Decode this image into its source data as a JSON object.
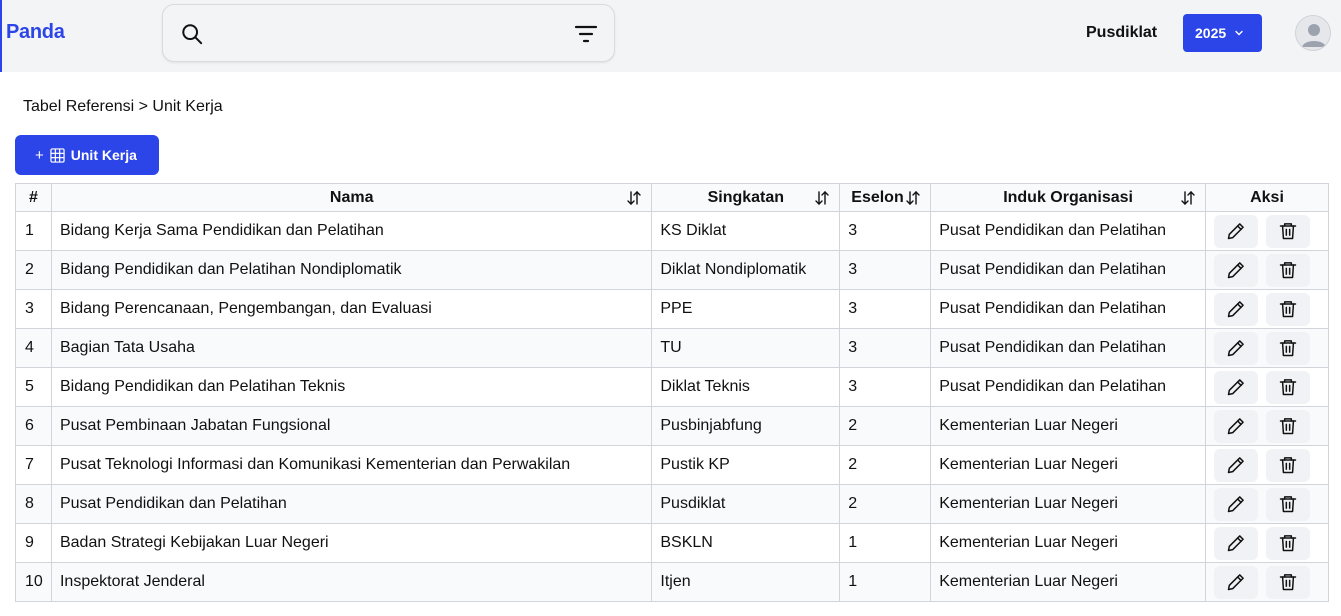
{
  "app": {
    "logo": "Panda",
    "organization": "Pusdiklat",
    "year": "2025",
    "search": {
      "value": ""
    }
  },
  "breadcrumb": "Tabel Referensi > Unit Kerja",
  "add_button": {
    "plus": "+",
    "label": "Unit Kerja"
  },
  "table": {
    "headers": {
      "num": "#",
      "nama": "Nama",
      "singkatan": "Singkatan",
      "eselon": "Eselon",
      "induk": "Induk Organisasi",
      "aksi": "Aksi"
    },
    "rows": [
      {
        "num": "1",
        "nama": "Bidang Kerja Sama Pendidikan dan Pelatihan",
        "singkatan": "KS Diklat",
        "eselon": "3",
        "induk": "Pusat Pendidikan dan Pelatihan"
      },
      {
        "num": "2",
        "nama": "Bidang Pendidikan dan Pelatihan Nondiplomatik",
        "singkatan": "Diklat Nondiplomatik",
        "eselon": "3",
        "induk": "Pusat Pendidikan dan Pelatihan"
      },
      {
        "num": "3",
        "nama": "Bidang Perencanaan, Pengembangan, dan Evaluasi",
        "singkatan": "PPE",
        "eselon": "3",
        "induk": "Pusat Pendidikan dan Pelatihan"
      },
      {
        "num": "4",
        "nama": "Bagian Tata Usaha",
        "singkatan": "TU",
        "eselon": "3",
        "induk": "Pusat Pendidikan dan Pelatihan"
      },
      {
        "num": "5",
        "nama": "Bidang Pendidikan dan Pelatihan Teknis",
        "singkatan": "Diklat Teknis",
        "eselon": "3",
        "induk": "Pusat Pendidikan dan Pelatihan"
      },
      {
        "num": "6",
        "nama": "Pusat Pembinaan Jabatan Fungsional",
        "singkatan": "Pusbinjabfung",
        "eselon": "2",
        "induk": "Kementerian Luar Negeri"
      },
      {
        "num": "7",
        "nama": "Pusat Teknologi Informasi dan Komunikasi Kementerian dan Perwakilan",
        "singkatan": "Pustik KP",
        "eselon": "2",
        "induk": "Kementerian Luar Negeri"
      },
      {
        "num": "8",
        "nama": "Pusat Pendidikan dan Pelatihan",
        "singkatan": "Pusdiklat",
        "eselon": "2",
        "induk": "Kementerian Luar Negeri"
      },
      {
        "num": "9",
        "nama": "Badan Strategi Kebijakan Luar Negeri",
        "singkatan": "BSKLN",
        "eselon": "1",
        "induk": "Kementerian Luar Negeri"
      },
      {
        "num": "10",
        "nama": "Inspektorat Jenderal",
        "singkatan": "Itjen",
        "eselon": "1",
        "induk": "Kementerian Luar Negeri"
      }
    ]
  },
  "icons": {
    "search": "search-icon",
    "filter": "filter-icon",
    "chevron": "chevron-down-icon",
    "avatar": "user-avatar-icon",
    "grid": "table-grid-icon",
    "sort": "sort-icon",
    "edit": "pencil-icon",
    "delete": "trash-icon"
  },
  "colors": {
    "primary": "#2c45e8",
    "topbar_bg": "#f3f4f6"
  }
}
